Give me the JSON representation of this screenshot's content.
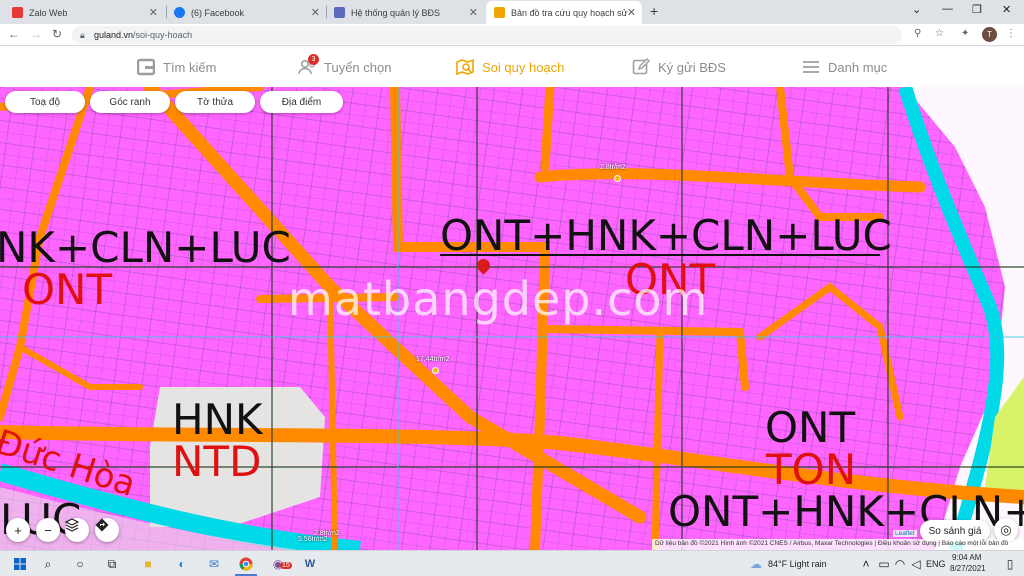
{
  "browser": {
    "tabs": [
      {
        "title": "Zalo Web",
        "favicon_color": "#e53935",
        "active": false
      },
      {
        "title": "(6) Facebook",
        "favicon_color": "#1877f2",
        "active": false
      },
      {
        "title": "Hệ thống quản lý BĐS",
        "favicon_color": "#5c6bc0",
        "active": false
      },
      {
        "title": "Bản đồ tra cứu quy hoạch sử dụng",
        "favicon_color": "#f0a500",
        "active": true
      }
    ],
    "new_tab": "+",
    "url": "guland.vn",
    "url_path": "/soi-quy-hoach",
    "profile_initial": "T"
  },
  "site_nav": {
    "items": [
      {
        "label": "Tìm kiếm",
        "icon": "guland-logo-icon",
        "active": false
      },
      {
        "label": "Tuyển chọn",
        "icon": "users-icon",
        "active": false,
        "badge": "3"
      },
      {
        "label": "Soi quy hoạch",
        "icon": "map-search-icon",
        "active": true
      },
      {
        "label": "Ký gửi BĐS",
        "icon": "edit-icon",
        "active": false
      },
      {
        "label": "Danh mục",
        "icon": "menu-icon",
        "active": false
      }
    ],
    "active_color": "#f0a500",
    "inactive_color": "#8d8d8d"
  },
  "map": {
    "filter_chips": [
      "Toạ độ",
      "Góc ranh",
      "Tờ thửa",
      "Địa điểm"
    ],
    "zone_labels": [
      {
        "text": "ONT+HNK+CLN+LUC",
        "color": "black"
      },
      {
        "text": "NK+CLN+LUC",
        "color": "black"
      },
      {
        "text": "ONT",
        "color": "red"
      },
      {
        "text": "ONT",
        "color": "red"
      },
      {
        "text": "HNK",
        "color": "black"
      },
      {
        "text": "NTD",
        "color": "red"
      },
      {
        "text": "Đức Hòa",
        "color": "red"
      },
      {
        "text": "ONT",
        "color": "black"
      },
      {
        "text": "TON",
        "color": "red"
      },
      {
        "text": "ONT+HNK+CLN+",
        "color": "black"
      },
      {
        "text": "LUC",
        "color": "black"
      }
    ],
    "price_markers": [
      "2.8tr/m2",
      "17.44tr/m2",
      "2.8tr/m2",
      "5.56tr/m2"
    ],
    "watermark": "matbangdep.com",
    "compare_button": "So sánh giá",
    "leaflet_label": "Leaflet",
    "attribution": "Dữ liệu bản đồ ©2021 Hình ảnh ©2021 CNES / Airbus, Maxar Technologies | Điều khoản sử dụng | Báo cáo một lỗi bản đồ",
    "land_color": "#ff66ff",
    "road_color": "#ff8a00"
  },
  "taskbar": {
    "weather": "84°F  Light rain",
    "language": "ENG",
    "time": "9:04 AM",
    "date": "8/27/2021",
    "viber_badge": "15"
  }
}
